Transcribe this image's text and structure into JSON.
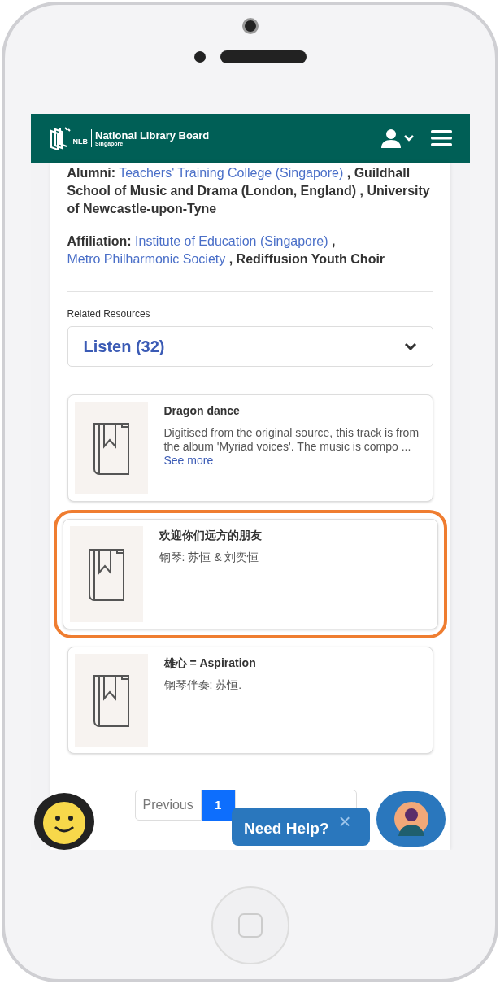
{
  "header": {
    "logo_title": "National Library Board",
    "logo_subtitle": "Singapore",
    "logo_mark": "NLB"
  },
  "details": [
    {
      "label": "Alumni:",
      "parts": [
        {
          "text": "Teachers' Training College (Singapore)",
          "link": true
        },
        {
          "text": " , ",
          "link": false
        },
        {
          "text": "Guildhall School of Music and Drama (London, England)",
          "link": false
        },
        {
          "text": " , University of Newcastle-upon-Tyne",
          "link": false
        }
      ]
    },
    {
      "label": "Affiliation:",
      "parts": [
        {
          "text": "Institute of Education (Singapore)",
          "link": true
        },
        {
          "text": " , ",
          "link": false
        },
        {
          "text": "Metro Philharmonic Society",
          "link": true
        },
        {
          "text": " , Rediffusion Youth Choir",
          "link": false
        }
      ]
    }
  ],
  "related": {
    "label": "Related Resources",
    "select_value": "Listen (32)"
  },
  "resources": [
    {
      "title": "Dragon dance",
      "description": "Digitised from the original source, this track is from the album 'Myriad voices'. The music is compo ...",
      "more": "See more",
      "highlighted": false
    },
    {
      "title": "欢迎你们远方的朋友",
      "description": "钢琴: 苏恒 & 刘奕恒",
      "highlighted": true
    },
    {
      "title": "雄心 = Aspiration",
      "description": "钢琴伴奏: 苏恒.",
      "highlighted": false
    }
  ],
  "pagination": {
    "previous": "Previous",
    "pages": [
      {
        "label": "1",
        "selected": true
      }
    ]
  },
  "help": {
    "text": "Need Help?",
    "close": "×"
  }
}
